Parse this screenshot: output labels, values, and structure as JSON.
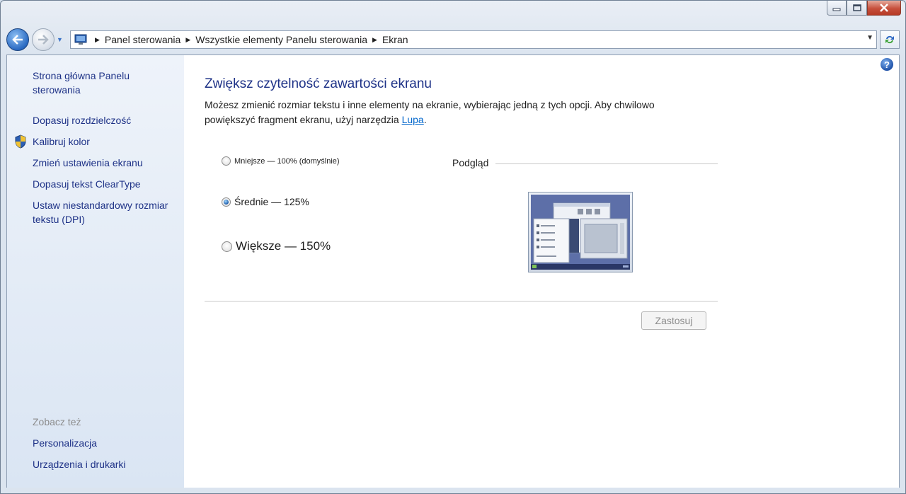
{
  "window": {
    "colors": {
      "accent": "#1e3287",
      "link": "#0066cc",
      "sidebar_top": "#eef3fa",
      "sidebar_bottom": "#dae5f3"
    }
  },
  "navbar": {
    "breadcrumbs": [
      "Panel sterowania",
      "Wszystkie elementy Panelu sterowania",
      "Ekran"
    ]
  },
  "sidebar": {
    "home_link": "Strona główna Panelu sterowania",
    "links": [
      "Dopasuj rozdzielczość",
      "Kalibruj kolor",
      "Zmień ustawienia ekranu",
      "Dopasuj tekst ClearType",
      "Ustaw niestandardowy rozmiar tekstu (DPI)"
    ],
    "see_also_title": "Zobacz też",
    "see_also": [
      "Personalizacja",
      "Urządzenia i drukarki"
    ]
  },
  "main": {
    "title": "Zwiększ czytelność zawartości ekranu",
    "description_before_link": "Możesz zmienić rozmiar tekstu i inne elementy na ekranie, wybierając jedną z tych opcji. Aby chwilowo powiększyć fragment ekranu, użyj narzędzia ",
    "link_text": "Lupa",
    "description_after_link": ".",
    "options": [
      {
        "label": "Mniejsze — 100% (domyślnie)",
        "checked": false
      },
      {
        "label": "Średnie — 125%",
        "checked": true
      },
      {
        "label": "Większe — 150%",
        "checked": false
      }
    ],
    "preview_label": "Podgląd",
    "apply_label": "Zastosuj",
    "help_icon": "?"
  }
}
